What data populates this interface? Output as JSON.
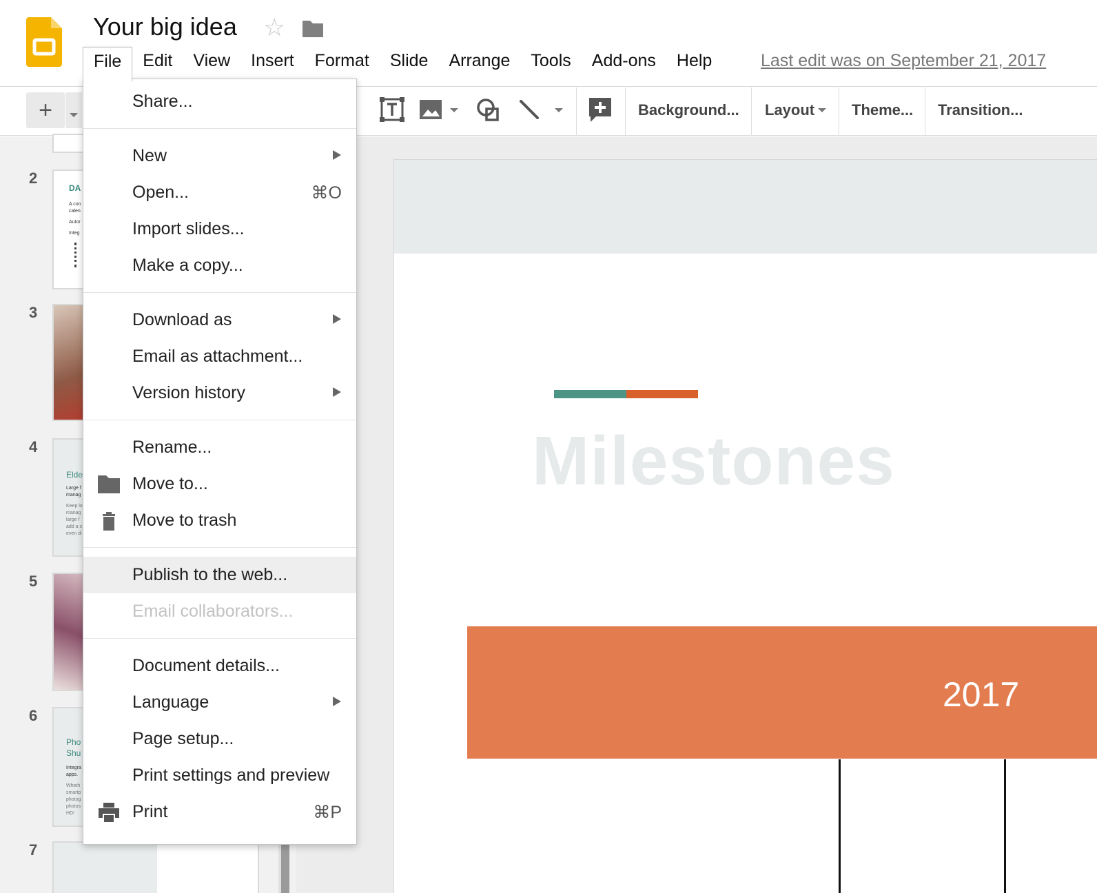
{
  "app": {
    "title": "Your big idea",
    "last_edit": "Last edit was on September 21, 2017"
  },
  "menubar": [
    "File",
    "Edit",
    "View",
    "Insert",
    "Format",
    "Slide",
    "Arrange",
    "Tools",
    "Add-ons",
    "Help"
  ],
  "toolbar": {
    "new_slide": "+",
    "background": "Background...",
    "layout": "Layout",
    "theme": "Theme...",
    "transition": "Transition..."
  },
  "file_menu": {
    "share": "Share...",
    "new": "New",
    "open": "Open...",
    "open_shortcut": "⌘O",
    "import_slides": "Import slides...",
    "make_copy": "Make a copy...",
    "download_as": "Download as",
    "email_attachment": "Email as attachment...",
    "version_history": "Version history",
    "rename": "Rename...",
    "move_to": "Move to...",
    "move_to_trash": "Move to trash",
    "publish": "Publish to the web...",
    "email_collaborators": "Email collaborators...",
    "document_details": "Document details...",
    "language": "Language",
    "page_setup": "Page setup...",
    "print_settings": "Print settings and preview",
    "print": "Print",
    "print_shortcut": "⌘P"
  },
  "filmstrip": {
    "numbers": [
      "2",
      "3",
      "4",
      "5",
      "6",
      "7"
    ],
    "thumb2": {
      "heading": "DA",
      "l1": "A con",
      "l2": "calen",
      "l3": "Autor",
      "l4": "Integ"
    },
    "thumb4": {
      "heading": "Elde",
      "l1": "Large f",
      "l2": "manag",
      "l3": "Keep lo",
      "l4": "manag",
      "l5": "large f",
      "l6": "add a s",
      "l7": "even di"
    },
    "thumb6": {
      "heading1": "Pho",
      "heading2": "Shu",
      "l1": "Integra",
      "l2": "apps.",
      "l3": "Wheth",
      "l4": "smartp",
      "l5": "photog",
      "l6": "photos",
      "l7": "HD!"
    }
  },
  "slide": {
    "title": "Milestones",
    "year": "2017"
  },
  "colors": {
    "teal": "#4b9486",
    "orange": "#d9602b",
    "year_bar": "#e37d50",
    "slides_yellow": "#f4b400"
  }
}
